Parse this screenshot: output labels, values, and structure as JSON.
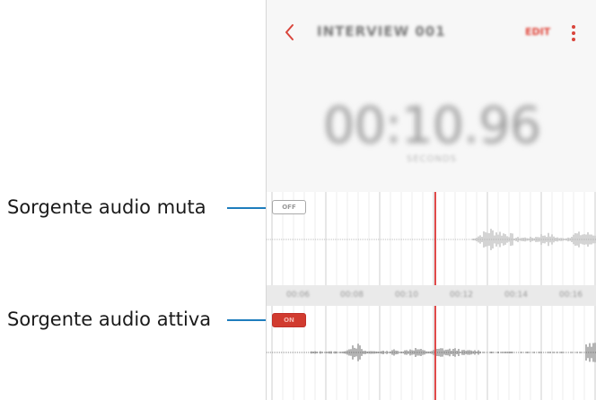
{
  "callouts": {
    "muted_source": "Sorgente audio muta",
    "active_source": "Sorgente audio attiva"
  },
  "app": {
    "title": "INTERVIEW 001",
    "edit_label": "EDIT",
    "timer": "00:10.96",
    "timer_sub": "SECONDS",
    "timeline_ticks": [
      "00:06",
      "00:08",
      "00:10",
      "00:12",
      "00:14",
      "00:16"
    ],
    "tracks": [
      {
        "toggle": "OFF",
        "state": "muted"
      },
      {
        "toggle": "ON",
        "state": "active"
      }
    ]
  },
  "colors": {
    "accent_red": "#d13b2f",
    "playhead": "#e04a4a",
    "callout_line": "#1e7dbd"
  },
  "icons": {
    "back": "chevron-left-icon",
    "more": "more-vertical-icon"
  }
}
